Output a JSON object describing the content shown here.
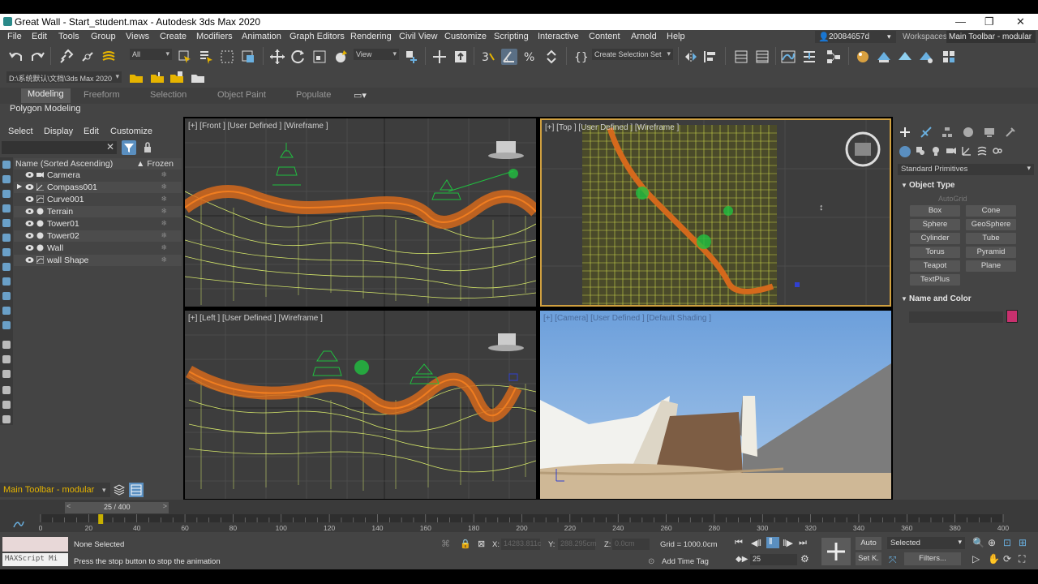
{
  "window": {
    "title": "Great Wall - Start_student.max - Autodesk 3ds Max 2020",
    "controls": [
      "—",
      "❐",
      "✕"
    ]
  },
  "menu": [
    "File",
    "Edit",
    "Tools",
    "Group",
    "Views",
    "Create",
    "Modifiers",
    "Animation",
    "Graph Editors",
    "Rendering",
    "Civil View",
    "Customize",
    "Scripting",
    "Interactive",
    "Content",
    "Arnold",
    "Help"
  ],
  "user": "20084657d",
  "workspace": {
    "label": "Workspaces:",
    "value": "Main Toolbar - modular"
  },
  "toolbar": {
    "filter": "All",
    "ref_coord": "View",
    "selection_set": "Create Selection Set",
    "path": "D:\\系统默认\\文档\\3ds Max 2020"
  },
  "ribbon": {
    "tabs": [
      "Modeling",
      "Freeform",
      "Selection",
      "Object Paint",
      "Populate"
    ],
    "active": "Modeling",
    "sub": "Polygon Modeling"
  },
  "scene_explorer": {
    "menu": [
      "Select",
      "Display",
      "Edit",
      "Customize"
    ],
    "col_name": "Name (Sorted Ascending)",
    "col_frozen": "▲ Frozen",
    "items": [
      "Carmera",
      "Compass001",
      "Curve001",
      "Terrain",
      "Tower01",
      "Tower02",
      "Wall",
      "wall Shape"
    ],
    "bottom_label": "Main Toolbar - modular"
  },
  "viewports": {
    "front": "[+] [Front ] [User Defined ] [Wireframe ]",
    "top": "[+] [Top ] [User Defined ] [Wireframe ]",
    "left": "[+] [Left ] [User Defined ] [Wireframe ]",
    "camera": "[+] [Camera] [User Defined ] [Default Shading ]"
  },
  "command_panel": {
    "dropdown": "Standard Primitives",
    "object_type": "Object Type",
    "autogrid": "AutoGrid",
    "buttons": [
      "Box",
      "Cone",
      "Sphere",
      "GeoSphere",
      "Cylinder",
      "Tube",
      "Torus",
      "Pyramid",
      "Teapot",
      "Plane",
      "TextPlus"
    ],
    "name_and_color": "Name and Color",
    "color": "#c8306e"
  },
  "timeline": {
    "frame": "25 / 400",
    "ticks": [
      "0",
      "20",
      "40",
      "60",
      "80",
      "100",
      "120",
      "140",
      "160",
      "180",
      "200",
      "220",
      "240",
      "260",
      "280",
      "300",
      "320",
      "340",
      "360",
      "380",
      "400"
    ],
    "current_frame": 25,
    "max_frame": 400
  },
  "status": {
    "maxscript": "MAXScript Mi",
    "selection": "None Selected",
    "prompt": "Press the stop button to stop the animation",
    "x_label": "X:",
    "x": "14283.811c",
    "y_label": "Y:",
    "y": "288.295cm",
    "z_label": "Z:",
    "z": "0.0cm",
    "grid": "Grid = 1000.0cm",
    "add_time_tag": "Add Time Tag",
    "frame_field": "25",
    "auto": "Auto",
    "set_key": "Set K.",
    "selected": "Selected",
    "filters": "Filters..."
  }
}
